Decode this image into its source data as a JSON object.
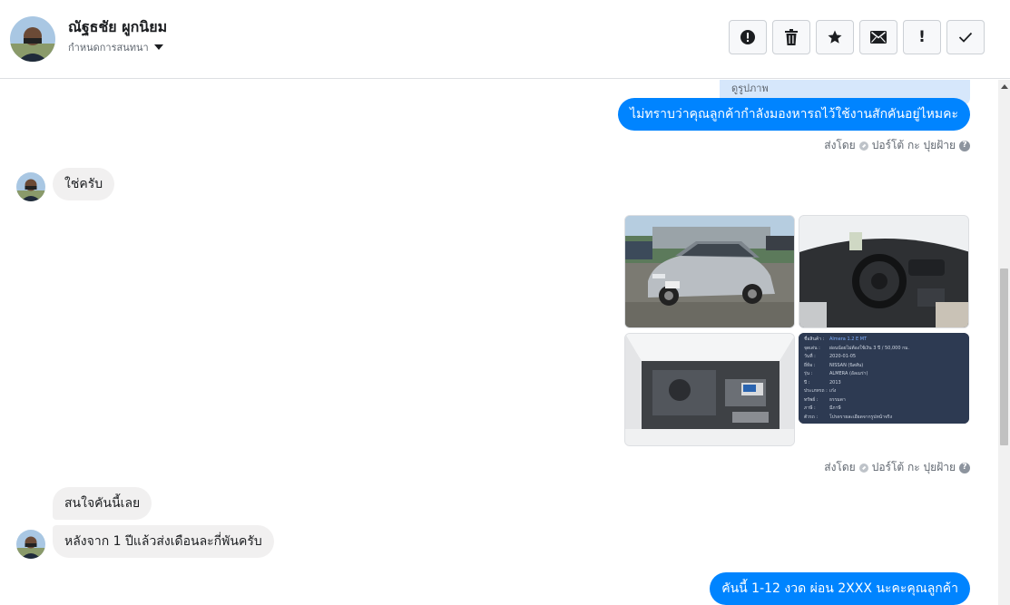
{
  "header": {
    "user_name": "ณัฐธชัย ผูกนิยม",
    "conversation_setting": "กำหนดการสนทนา",
    "actions": [
      {
        "name": "report-spam-button",
        "icon": "exclamation-circle-icon",
        "glyph": "!"
      },
      {
        "name": "delete-button",
        "icon": "trash-icon",
        "glyph": ""
      },
      {
        "name": "star-button",
        "icon": "star-icon",
        "glyph": "★"
      },
      {
        "name": "mark-unread-button",
        "icon": "envelope-icon",
        "glyph": ""
      },
      {
        "name": "important-button",
        "icon": "exclamation-icon",
        "glyph": "!"
      },
      {
        "name": "mark-done-button",
        "icon": "check-icon",
        "glyph": "✓"
      }
    ]
  },
  "messages": {
    "prev_card_text": "ดูรูปภาพ",
    "m1_out": "ไม่ทราบว่าคุณลูกค้ากำลังมองหารถไว้ใช้งานสักคันอยู่ไหมคะ",
    "sent_by_label": "ส่งโดย",
    "sender_name": "ปอร์โต้ กะ ปุยฝ้าย",
    "m2_in": "ใช่ครับ",
    "m3_in": "สนใจคันนี้เลย",
    "m4_in": "หลังจาก 1 ปีแล้วส่งเดือนละกี่พันครับ",
    "m5_out": "คันนี้ 1-12 งวด ผ่อน 2XXX นะคะคุณลูกค้า"
  },
  "spec_sheet": {
    "rows": [
      {
        "k": "ชื่อสินค้า :",
        "v": "Almera 1.2 E MT"
      },
      {
        "k": "จุดเด่น :",
        "v": "ผ่อนน้อยไม่ต้องใช้เงิน 3 ปี / 50,000 กม."
      },
      {
        "k": "วันที่ :",
        "v": "2020-01-05"
      },
      {
        "k": "ยี่ห้อ :",
        "v": "NISSAN (นิสสัน)"
      },
      {
        "k": "รุ่น :",
        "v": "ALMERA (อัลเมร่า)"
      },
      {
        "k": "ปี :",
        "v": "2013"
      },
      {
        "k": "ประเภทรถ :",
        "v": "เก๋ง"
      },
      {
        "k": "ทรัพย์ :",
        "v": "ธรรมดา"
      },
      {
        "k": "ภาษี :",
        "v": "มีภาษี"
      },
      {
        "k": "ตัวรถ :",
        "v": "โปรดรายละเอียดจากรูปหน้าจริง"
      }
    ]
  },
  "colors": {
    "accent": "#0084ff",
    "incoming_bubble": "#f1f0f0",
    "spec_bg": "#2d3a52"
  }
}
